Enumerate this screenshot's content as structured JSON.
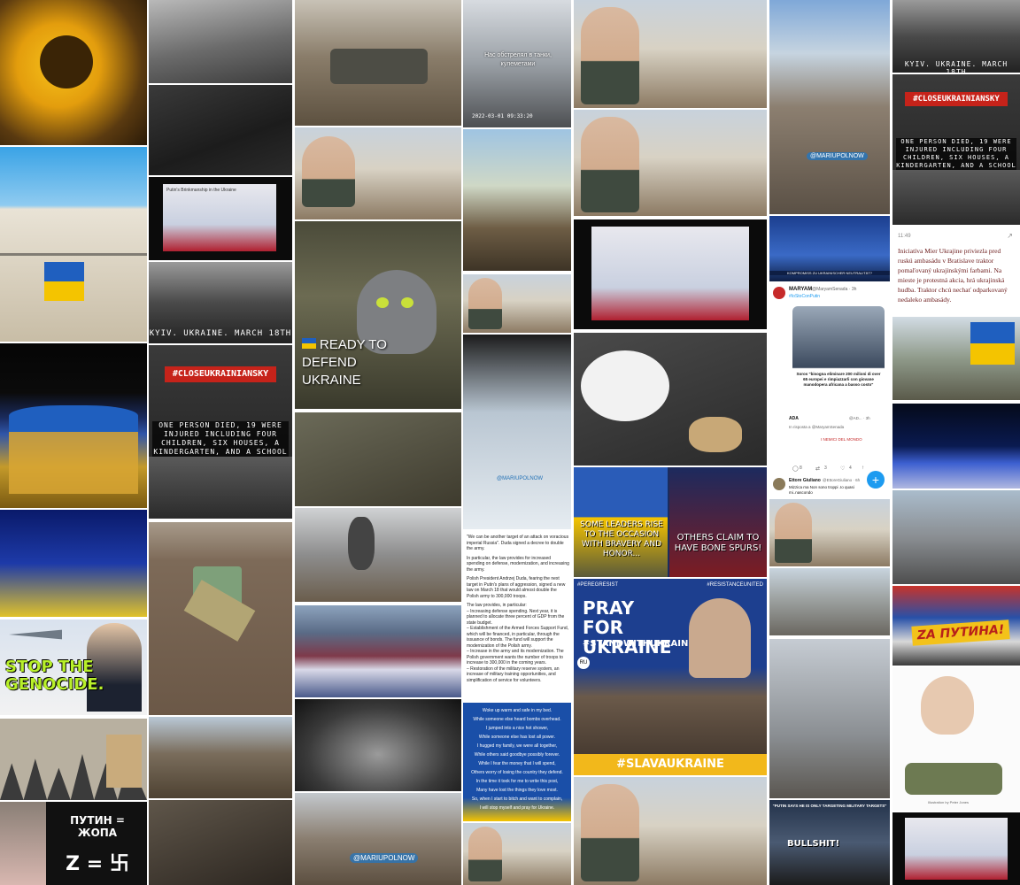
{
  "captions": {
    "tank_clip": "Нас обстрелял в танки, кулеметами",
    "tank_clip_time": "2022-03-01 09:33:20",
    "cat_title": "READY TO DEFEND UKRAINE",
    "kyiv": "KYIV. UKRAINE. MARCH 18TH",
    "close_sky": "#CLOSEUKRAINIANSKY",
    "casualties": "ONE PERSON DIED, 19 WERE INJURED INCLUDING FOUR CHILDREN, SIX HOUSES, A KINDERGARTEN, AND A SCHOOL WEREDAMAGED",
    "casualties_b": "ONE PERSON DIED, 19 WERE INJURED INCLUDING FOUR CHILDREN, SIX HOUSES, A KINDERGARTEN, AND A SCHOOL WEREDAMAGED",
    "stop_genocide": "STOP THE GENOCIDE.",
    "putin_eq": "ПУТИН = ЖОПА",
    "z_eq": "Z = 卐",
    "telegram_tag": "@MARIUPOLNOW",
    "telegram_tag2": "@MARIUPOLNOW",
    "telegram_tag3": "@MARIUPOLNOW",
    "leaders_left": "SOME LEADERS RISE TO THE OCCASION WITH BRAVERY AND HONOR...",
    "leaders_right": "OTHERS CLAIM TO HAVE BONE SPURS!",
    "pray_tag_left": "#PEREGRESIST",
    "pray_tag_right": "#RESISTANCEUNITED",
    "pray_title": "PRAY FOR UKRAINE",
    "pray_sub": "#STANDWITHUKRAINE",
    "slava": "#SLAVAUKRAINE",
    "pray_ru": "RU",
    "za_putina": "ZA ПУТИНА!",
    "tv_ticker": "KOMPROMISS ZU UKRAINISCHER NEUTRALITÄT?",
    "putin_military": "\"PUTIN SAYS HE IS ONLY TARGETING MILITARY TARGETS\"",
    "bullshit": "BULLSHIT!",
    "caricature_credit": "Illustration by Peter Jones",
    "news_slide": "Putin's Brinkmanship in the Ukraine",
    "poem": [
      "Woke up warm and safe in my bed.",
      "While someone else heard bombs overhead.",
      "I jumped into a nice hot shower,",
      "While someone else has lost all power.",
      "I hugged my family, we were all together,",
      "While others said goodbye possibly forever.",
      "While I fear the money that I will spend,",
      "Others worry of losing the country they defend.",
      "In the time it took for me to write this post,",
      "Many have lost the things they love most.",
      "So, when I start to bitch and want to complain,",
      "I will stop myself and pray for Ukraine."
    ]
  },
  "article": {
    "quote": "\"We can be another target of an attack on voracious imperial Russia\". Duda signed a decree to double the army.",
    "p1": "In particular, the law provides for increased spending on defense, modernization, and increasing the army.",
    "p2": "Polish President Andrzej Duda, fearing the next target in Putin's plans of aggression, signed a new law on March 18 that would almost double the Polish army to 300,000 troops.",
    "p3": "The law provides, in particular:",
    "p4": "– Increasing defense spending. Next year, it is planned to allocate three percent of GDP from the state budget.",
    "p5": "– Establishment of the Armed Forces Support Fund, which will be financed, in particular, through the issuance of bonds. The fund will support the modernization of the Polish army.",
    "p6": "– Increase in the army and its modernization. The Polish government wants the number of troops to increase to 300,000 in the coming years.",
    "p7": "– Restoration of the military reserve system, an increase of military training opportunities, and simplification of service for volunteers."
  },
  "tweet": {
    "author": "MARYAM",
    "handle": "@MaryamSenada · 3h",
    "tag": "#IoStoConPutin",
    "card_text": "Soros \"bisogna eliminare 200 milioni di over 65 europei e rimpiazzarli con giovane manodopera africana a basso costo\"",
    "reply_author": "ADA",
    "reply_handle": "@AD... · 3h",
    "reply_to": "In risposta a @MaryamSenada",
    "enemies": "I NEMICI DEL MONDO",
    "reply_count": "8",
    "retweet_count": "3",
    "like_count": "4",
    "commenter": "Ettore Giuliano",
    "commenter_handle": "@EttoreGiuliano · 6h",
    "commenter_text": "Mizzica ma Non sono troppi .Io quasi mi..nascondo"
  },
  "post": {
    "time": "11:49",
    "text": "Iniciatíva Mier Ukrajine priviezla pred ruskú ambasádu v Bratislave traktor pomaľovaný ukrajinskými farbami. Na mieste je protestná akcia, hrá ukrajinská hudba. Traktor chcú nechať odparkovaný nedaleko ambasády."
  },
  "colors": {
    "ukraine_blue": "#1f5fbf",
    "ukraine_yellow": "#f4c400",
    "banner_red": "#c6231a",
    "pray_bg": "#1d3f8f",
    "slava_bar": "#f2b81b"
  }
}
